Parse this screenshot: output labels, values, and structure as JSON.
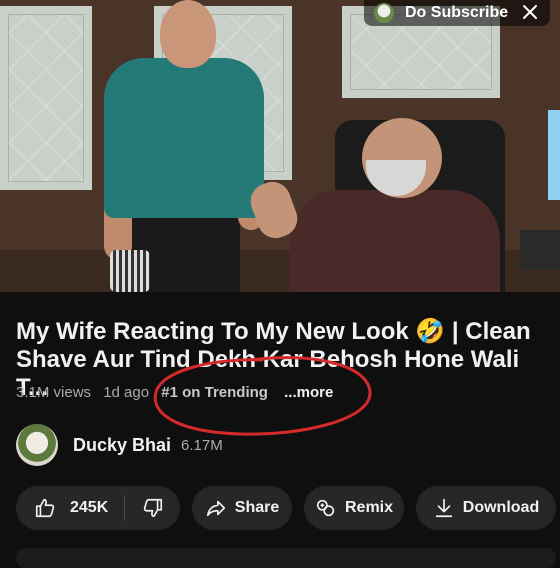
{
  "overlay": {
    "subscribe_label": "Do Subscribe",
    "close_icon": "close-icon"
  },
  "video": {
    "title": "My Wife Reacting To My New Look 🤣 | Clean Shave Aur Tind Dekh Kar Behosh Hone Wali T...",
    "views": "3.1M views",
    "age": "1d ago",
    "trending": "#1 on Trending",
    "more": "...more"
  },
  "channel": {
    "name": "Ducky Bhai",
    "subscribers": "6.17M"
  },
  "actions": {
    "like_count": "245K",
    "share_label": "Share",
    "remix_label": "Remix",
    "download_label": "Download",
    "icons": [
      "thumbs-up-icon",
      "thumbs-down-icon",
      "share-arrow-icon",
      "remix-icon",
      "download-icon"
    ]
  },
  "colors": {
    "background": "#0f0f0f",
    "pill": "#272727",
    "annotation_circle": "#d42a2a"
  }
}
